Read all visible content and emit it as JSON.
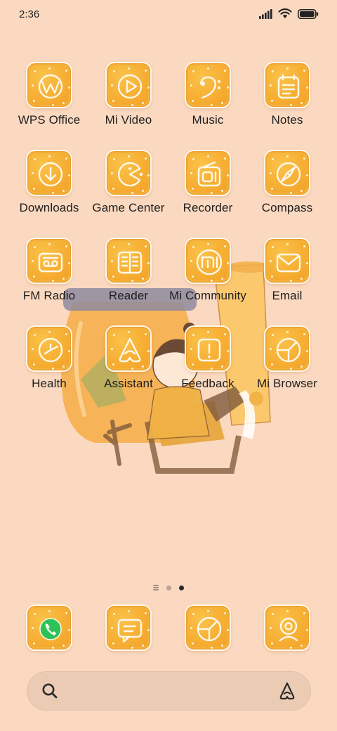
{
  "status_bar": {
    "time": "2:36",
    "icons": [
      "signal-icon",
      "wifi-icon",
      "battery-icon"
    ]
  },
  "apps": [
    {
      "label": "WPS Office",
      "icon": "wps-icon"
    },
    {
      "label": "Mi Video",
      "icon": "play-icon"
    },
    {
      "label": "Music",
      "icon": "bass-clef-icon"
    },
    {
      "label": "Notes",
      "icon": "notes-icon"
    },
    {
      "label": "Downloads",
      "icon": "download-icon"
    },
    {
      "label": "Game Center",
      "icon": "pacman-icon"
    },
    {
      "label": "Recorder",
      "icon": "recorder-icon"
    },
    {
      "label": "Compass",
      "icon": "compass-icon"
    },
    {
      "label": "FM Radio",
      "icon": "radio-icon"
    },
    {
      "label": "Reader",
      "icon": "book-icon"
    },
    {
      "label": "Mi Community",
      "icon": "mi-logo-icon"
    },
    {
      "label": "Email",
      "icon": "envelope-icon"
    },
    {
      "label": "Health",
      "icon": "clock-icon"
    },
    {
      "label": "Assistant",
      "icon": "assistant-icon"
    },
    {
      "label": "Feedback",
      "icon": "exclamation-icon"
    },
    {
      "label": "Mi Browser",
      "icon": "browser-icon"
    }
  ],
  "dock": [
    {
      "icon": "phone-icon"
    },
    {
      "icon": "message-icon"
    },
    {
      "icon": "browser-icon"
    },
    {
      "icon": "camera-icon"
    }
  ],
  "page_indicator": {
    "pages": 2,
    "active": 2
  },
  "search_bar": {
    "icons": [
      "search-icon",
      "assistant-icon"
    ]
  },
  "colors": {
    "background": "#fbd9c0",
    "icon_tile": "#f7b33a",
    "icon_border": "#fff7e6",
    "phone_green": "#2bc25a"
  }
}
